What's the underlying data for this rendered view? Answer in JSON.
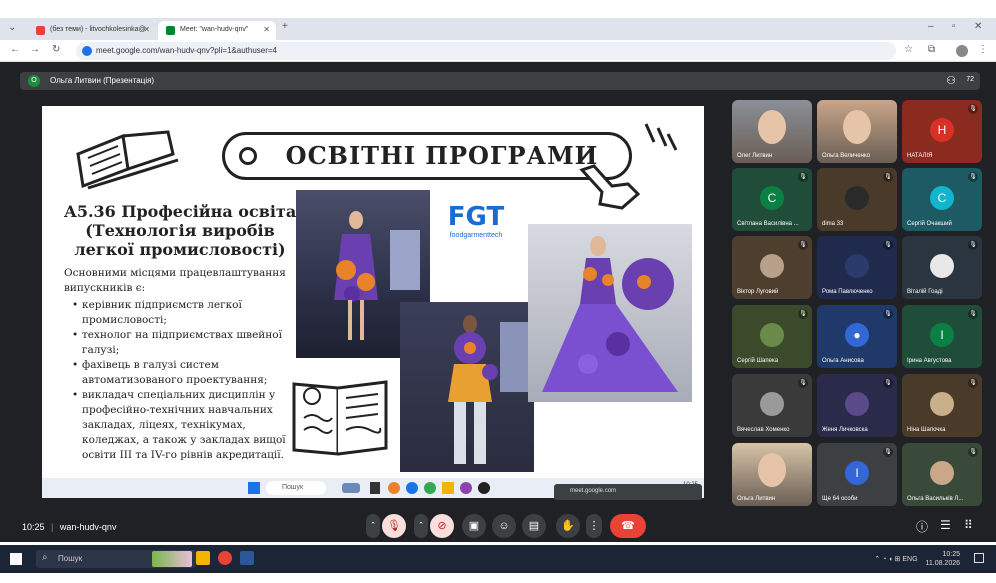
{
  "browser": {
    "tabs": [
      {
        "label": "(без теми) - litvochkolesinka@",
        "color": "#ea4335"
      },
      {
        "label": "Meet: \"wan-hudv-qnv\"",
        "color": "#00832d"
      }
    ],
    "url": "meet.google.com/wan-hudv-qnv?pli=1&authuser=4"
  },
  "meet": {
    "presenter": "Ольга Литвин (Презентація)",
    "presenter_initial": "О",
    "people_count": "72",
    "meeting_code": "wan-hudv-qnv",
    "time": "10:25"
  },
  "slide": {
    "title": "ОСВІТНІ ПРОГРАМИ",
    "subtitle": "А5.36 Професійна освіта (Технологія виробів легкої промисловості)",
    "intro": "Основними місцями працевлаштування випускників є:",
    "bullets": [
      "керівник підприємств легкої промисловості;",
      "технолог на підприємствах швейної галузі;",
      "фахівець в галузі систем автоматизованого проектування;",
      "викладач спеціальних дисциплін у професійно-технічних навчальних закладах, ліцеях, технікумах, коледжах, а також у закладах вищої освіти III та IV-го рівнів акредитації."
    ],
    "logo_text": "FGT",
    "logo_sub": "foodgarmenttech"
  },
  "inner_taskbar": {
    "search": "Пошук",
    "share_popup": "meet.google.com",
    "time": "10:25"
  },
  "participants": [
    {
      "name": "Олег Литвин",
      "type": "video",
      "color": "#8a8f98"
    },
    {
      "name": "Ольга Величенко",
      "type": "video",
      "color": "#c9a58a"
    },
    {
      "name": "НАТАЛІЯ",
      "type": "avatar",
      "initial": "Н",
      "color": "#d93025",
      "bg": "#8b2a1f"
    },
    {
      "name": "Світлана Василівна ...",
      "type": "avatar",
      "initial": "С",
      "color": "#0b8043",
      "bg": "#1f4d3a"
    },
    {
      "name": "dima 33",
      "type": "photo",
      "color": "#2a2a2a",
      "bg": "#4a3a2a"
    },
    {
      "name": "Сергій Очакший",
      "type": "avatar",
      "initial": "С",
      "color": "#12b5cb",
      "bg": "#1e5a63"
    },
    {
      "name": "Віктор Луговий",
      "type": "photo",
      "color": "#b7a08a",
      "bg": "#4d3e2e"
    },
    {
      "name": "Рома Павлюченко",
      "type": "photo",
      "color": "#2a3a6a",
      "bg": "#1f2a4d"
    },
    {
      "name": "Віталій Гоаді",
      "type": "photo",
      "color": "#e8e8e8",
      "bg": "#2a3540"
    },
    {
      "name": "Сергій Шапека",
      "type": "photo",
      "color": "#6a8a4a",
      "bg": "#3a4a2a"
    },
    {
      "name": "Ольга Анисова",
      "type": "avatar",
      "initial": "●",
      "color": "#3367d6",
      "bg": "#1f3a6a"
    },
    {
      "name": "Ірина Августова",
      "type": "avatar",
      "initial": "І",
      "color": "#0b8043",
      "bg": "#1f4d3a"
    },
    {
      "name": "Вячеслав Хоменко",
      "type": "photo",
      "color": "#9a9a9a",
      "bg": "#3a3a3a"
    },
    {
      "name": "Женя Личковска",
      "type": "photo",
      "color": "#5a4a8a",
      "bg": "#2a2a4a"
    },
    {
      "name": "Ніна Шапочка",
      "type": "photo",
      "color": "#c9b08a",
      "bg": "#4a3a2a"
    },
    {
      "name": "Ольга Литвин",
      "type": "video",
      "color": "#d7c4a8"
    },
    {
      "name": "Ще 64 особи",
      "type": "more",
      "initial": "I",
      "color": "#3367d6",
      "bg": "#3c4043"
    },
    {
      "name": "Ольга Васильків Л...",
      "type": "photo",
      "color": "#c9a88a",
      "bg": "#3a4a3a"
    }
  ],
  "taskbar": {
    "search": "Пошук",
    "lang": "ENG",
    "time": "10:25",
    "date": "11.08.2026"
  }
}
